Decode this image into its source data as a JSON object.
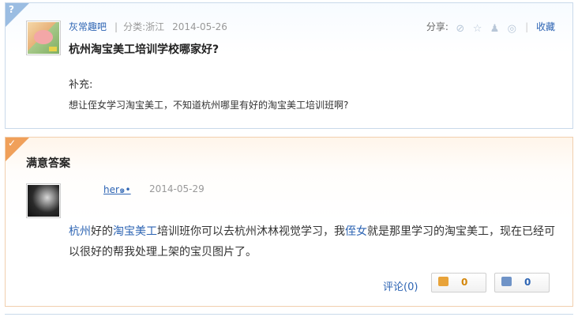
{
  "question": {
    "corner_glyph": "?",
    "user": "灰常趣吧",
    "separator": "|",
    "category_label": "分类:",
    "category_value": "浙江",
    "date": "2014-05-26",
    "title": "杭州淘宝美工培训学校哪家好?",
    "supplement_label": "补充:",
    "supplement_text": "想让侄女学习淘宝美工，不知道杭州哪里有好的淘宝美工培训班啊?"
  },
  "share": {
    "label": "分享:",
    "icons": [
      "search-share-icon",
      "star-share-icon",
      "qq-share-icon",
      "weibo-share-icon"
    ],
    "separator": "|",
    "favorite_label": "收藏"
  },
  "answer": {
    "corner_glyph": "✓",
    "heading": "满意答案",
    "user": "her๑•",
    "date": "2014-05-29",
    "body": {
      "kw1": "杭州",
      "t1": "好的",
      "kw2": "淘宝美工",
      "t2": "培训班你可以去杭州沐林视觉学习，我",
      "kw3": "侄女",
      "t3": "就是那里学习的淘宝美工，现在已经可以很好的帮我处理上架的宝贝图片了。"
    },
    "comment_label": "评论(0)",
    "upvote_count": "0",
    "downvote_count": "0"
  },
  "colors": {
    "link": "#2d64b3",
    "question_corner": "#9bbde2",
    "answer_corner": "#f0a05a",
    "upvote": "#d4860a"
  }
}
